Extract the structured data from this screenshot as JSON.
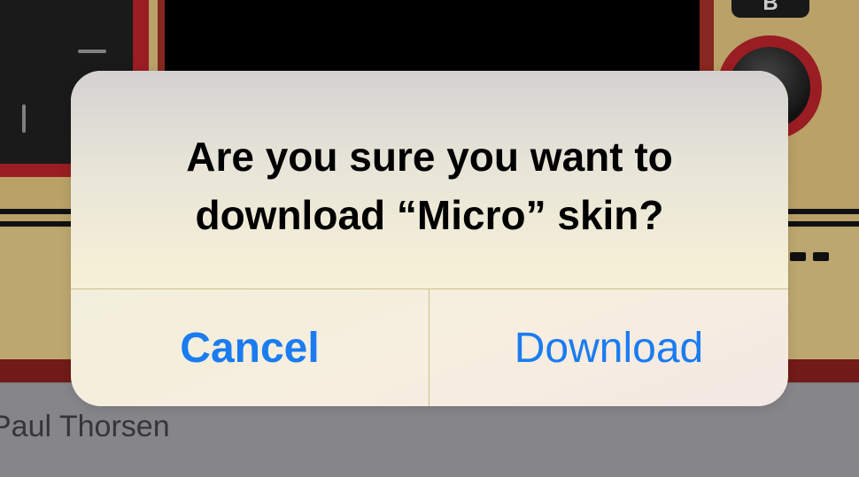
{
  "background": {
    "skin_preview": {
      "button_b_label": "B"
    },
    "author_row": {
      "author_name": "Paul Thorsen"
    }
  },
  "alert": {
    "message": "Are you sure you want to download “Micro” skin?",
    "cancel_label": "Cancel",
    "download_label": "Download"
  },
  "colors": {
    "accent": "#1a7cf0",
    "skin_gold": "#c5ac6f",
    "skin_red": "#8f2a23",
    "row_grey": "#8e8e93"
  }
}
